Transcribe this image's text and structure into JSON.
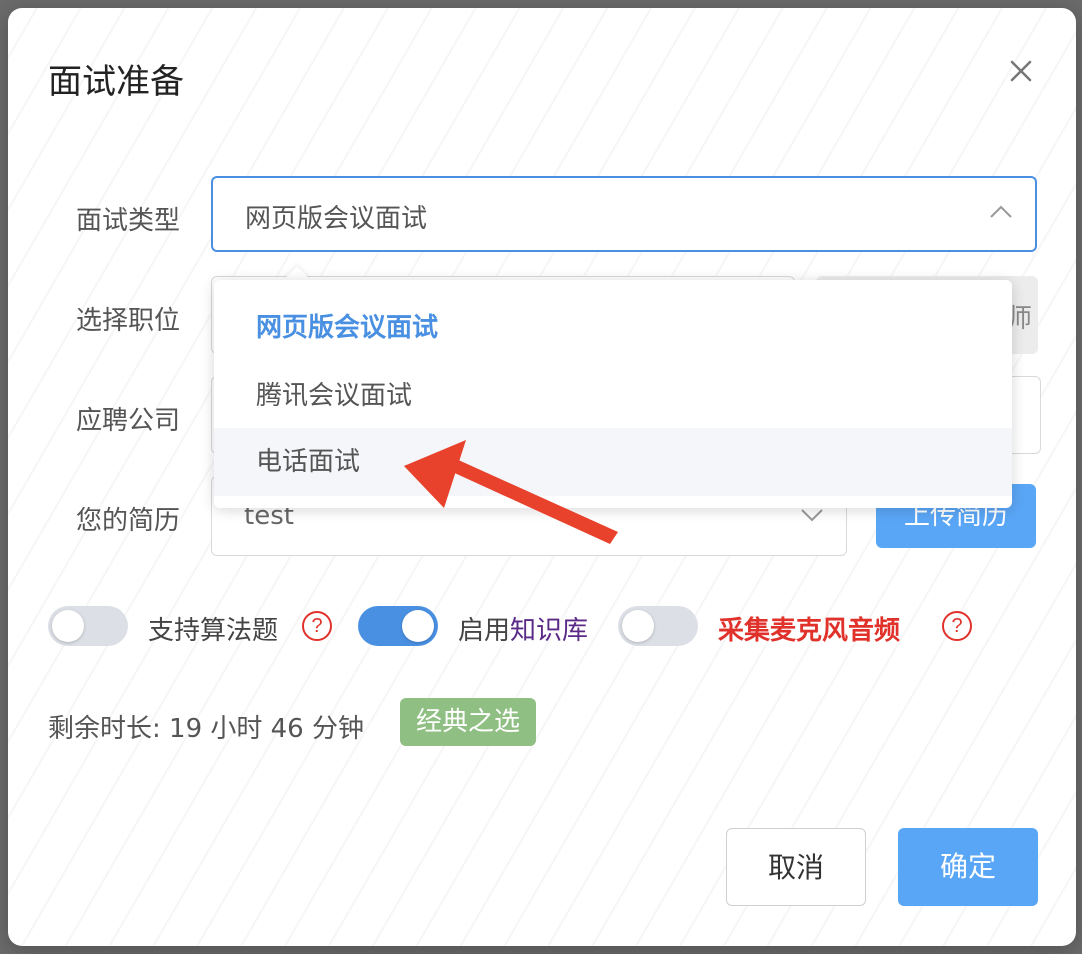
{
  "dialog": {
    "title": "面试准备",
    "close_icon": "close-icon"
  },
  "form": {
    "interview_type_label": "面试类型",
    "interview_type_value": "网页版会议面试",
    "position_label": "选择职位",
    "position_side_partial": "师",
    "company_label": "应聘公司",
    "resume_label": "您的简历",
    "resume_value": "test",
    "upload_button": "上传简历"
  },
  "dropdown": {
    "options": [
      {
        "label": "网页版会议面试",
        "state": "selected"
      },
      {
        "label": "腾讯会议面试",
        "state": "normal"
      },
      {
        "label": "电话面试",
        "state": "hover"
      }
    ]
  },
  "toggles": {
    "algorithm": {
      "label": "支持算法题",
      "on": false
    },
    "knowledge": {
      "prefix": "启用",
      "link": "知识库",
      "on": true
    },
    "mic": {
      "label": "采集麦克风音频",
      "on": false
    },
    "help_glyph": "?"
  },
  "status": {
    "remaining": "剩余时长: 19 小时 46 分钟",
    "badge": "经典之选"
  },
  "footer": {
    "cancel": "取消",
    "confirm": "确定"
  },
  "colors": {
    "accent": "#4a90e2",
    "button_blue": "#5aa6f6",
    "danger": "#e0322b",
    "badge_green": "#8fbf82",
    "link_purple": "#5b2a86"
  }
}
